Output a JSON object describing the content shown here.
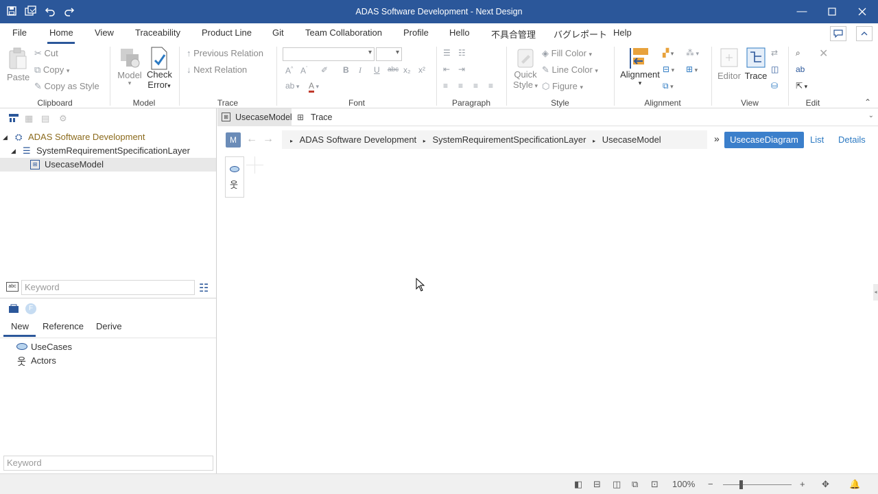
{
  "window": {
    "title": "ADAS Software Development - Next Design"
  },
  "menu": {
    "items": [
      "File",
      "Home",
      "View",
      "Traceability",
      "Product Line",
      "Git",
      "Team Collaboration",
      "Profile",
      "Hello",
      "不具合管理",
      "バグレポート",
      "Help"
    ],
    "active": "Home"
  },
  "ribbon": {
    "clipboard": {
      "paste": "Paste",
      "cut": "Cut",
      "copy": "Copy",
      "copy_as_style": "Copy as Style",
      "label": "Clipboard"
    },
    "model": {
      "model": "Model",
      "check": "Check",
      "error": "Error",
      "label": "Model"
    },
    "trace": {
      "previous": "Previous Relation",
      "next": "Next Relation",
      "label": "Trace"
    },
    "font": {
      "label": "Font",
      "bold": "B",
      "italic": "I",
      "underline": "U",
      "strike": "abc",
      "sub": "x₂",
      "sup": "x²"
    },
    "paragraph": {
      "label": "Paragraph"
    },
    "style": {
      "quick": "Quick",
      "style_word": "Style",
      "fill": "Fill Color",
      "line": "Line Color",
      "figure": "Figure",
      "label": "Style"
    },
    "alignment": {
      "alignment": "Alignment",
      "label": "Alignment"
    },
    "view": {
      "editor": "Editor",
      "trace": "Trace",
      "label": "View"
    },
    "edit": {
      "label": "Edit"
    }
  },
  "tree": {
    "items": [
      {
        "label": "ADAS Software Development",
        "color": "#8b6a1c"
      },
      {
        "label": "SystemRequirementSpecificationLayer",
        "color": "#333333"
      },
      {
        "label": "UsecaseModel",
        "color": "#333333"
      }
    ]
  },
  "search": {
    "placeholder1": "Keyword",
    "placeholder2": "Keyword"
  },
  "palette_tabs": [
    "New",
    "Reference",
    "Derive"
  ],
  "palette_items": [
    "UseCases",
    "Actors"
  ],
  "doctabs": [
    "UsecaseModel",
    "Trace"
  ],
  "breadcrumb": {
    "badge": "M",
    "items": [
      "ADAS Software Development",
      "SystemRequirementSpecificationLayer",
      "UsecaseModel"
    ],
    "more": "»"
  },
  "view_buttons": {
    "diagram": "UsecaseDiagram",
    "list": "List",
    "details": "Details"
  },
  "status": {
    "zoom": "100%"
  },
  "colors": {
    "accent": "#2b579a",
    "highlight_button": "#3b7fcb"
  }
}
